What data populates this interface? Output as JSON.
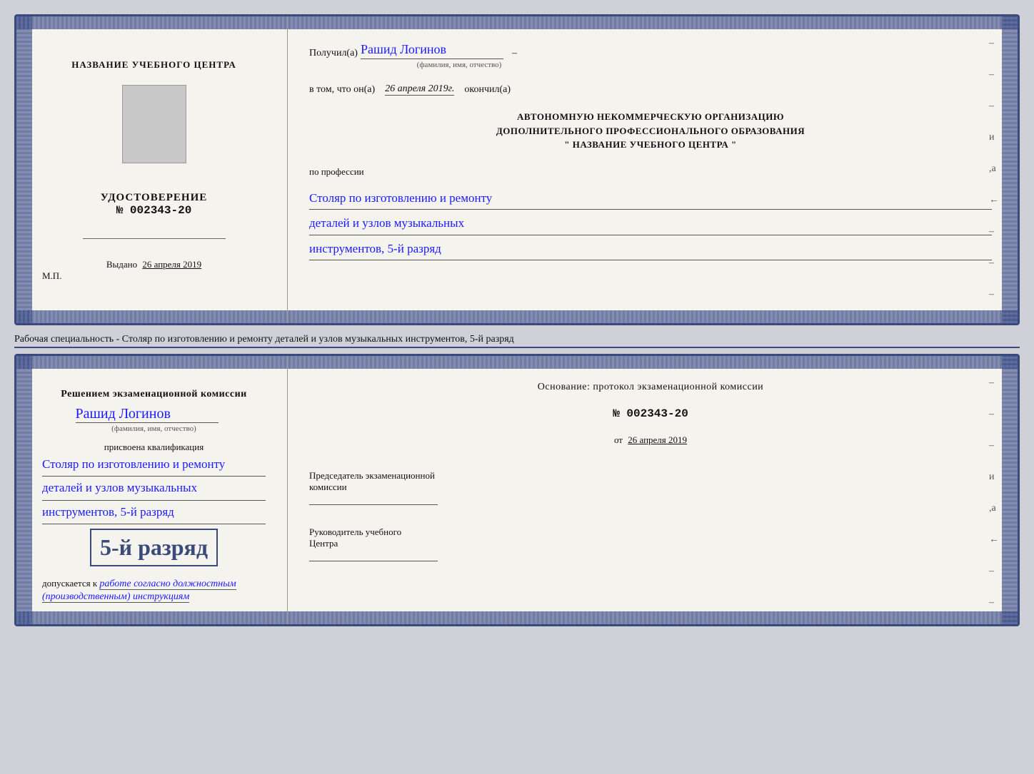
{
  "card1": {
    "left": {
      "center_title": "НАЗВАНИЕ УЧЕБНОГО ЦЕНТРА",
      "udostoverenie": "УДОСТОВЕРЕНИЕ",
      "nomer": "№ 002343-20",
      "vydano_label": "Выдано",
      "vydano_date": "26 апреля 2019",
      "mp_label": "М.П."
    },
    "right": {
      "poluchil_label": "Получил(а)",
      "poluchil_name": "Рашид Логинов",
      "fio_label": "(фамилия, имя, отчество)",
      "dash1": "–",
      "vtom_label": "в том, что он(а)",
      "vtom_date": "26 апреля 2019г.",
      "okonchil_label": "окончил(а)",
      "org_line1": "АВТОНОМНУЮ НЕКОММЕРЧЕСКУЮ ОРГАНИЗАЦИЮ",
      "org_line2": "ДОПОЛНИТЕЛЬНОГО ПРОФЕССИОНАЛЬНОГО ОБРАЗОВАНИЯ",
      "org_line3": "\" НАЗВАНИЕ УЧЕБНОГО ЦЕНТРА \"",
      "po_professii": "по профессии",
      "profession_line1": "Столяр по изготовлению и ремонту",
      "profession_line2": "деталей и узлов музыкальных",
      "profession_line3": "инструментов, 5-й разряд"
    }
  },
  "specialty_text": "Рабочая специальность - Столяр по изготовлению и ремонту деталей и узлов музыкальных инструментов, 5-й разряд",
  "card2": {
    "left": {
      "resheniem_label": "Решением  экзаменационной  комиссии",
      "person_name": "Рашид Логинов",
      "fio_label": "(фамилия, имя, отчество)",
      "prisvoena_label": "присвоена квалификация",
      "qualification_line1": "Столяр по изготовлению и ремонту",
      "qualification_line2": "деталей и узлов музыкальных",
      "qualification_line3": "инструментов, 5-й разряд",
      "razryad_big": "5-й разряд",
      "dopuskaetsya_label": "допускается к",
      "dopuskaetsya_hw": "работе согласно должностным",
      "dopuskaetsya_hw2": "(производственным) инструкциям"
    },
    "right": {
      "osnovanie_label": "Основание: протокол экзаменационной  комиссии",
      "nomer_protokol": "№  002343-20",
      "ot_label": "от",
      "ot_date": "26 апреля 2019",
      "predsedatel_label": "Председатель экзаменационной",
      "predsedatel_label2": "комиссии",
      "rukovoditel_label": "Руководитель учебного",
      "rukovoditel_label2": "Центра"
    }
  },
  "decorations": {
    "dashes": [
      "–",
      "–",
      "–",
      "и",
      ",а",
      "←",
      "–",
      "–",
      "–"
    ]
  }
}
